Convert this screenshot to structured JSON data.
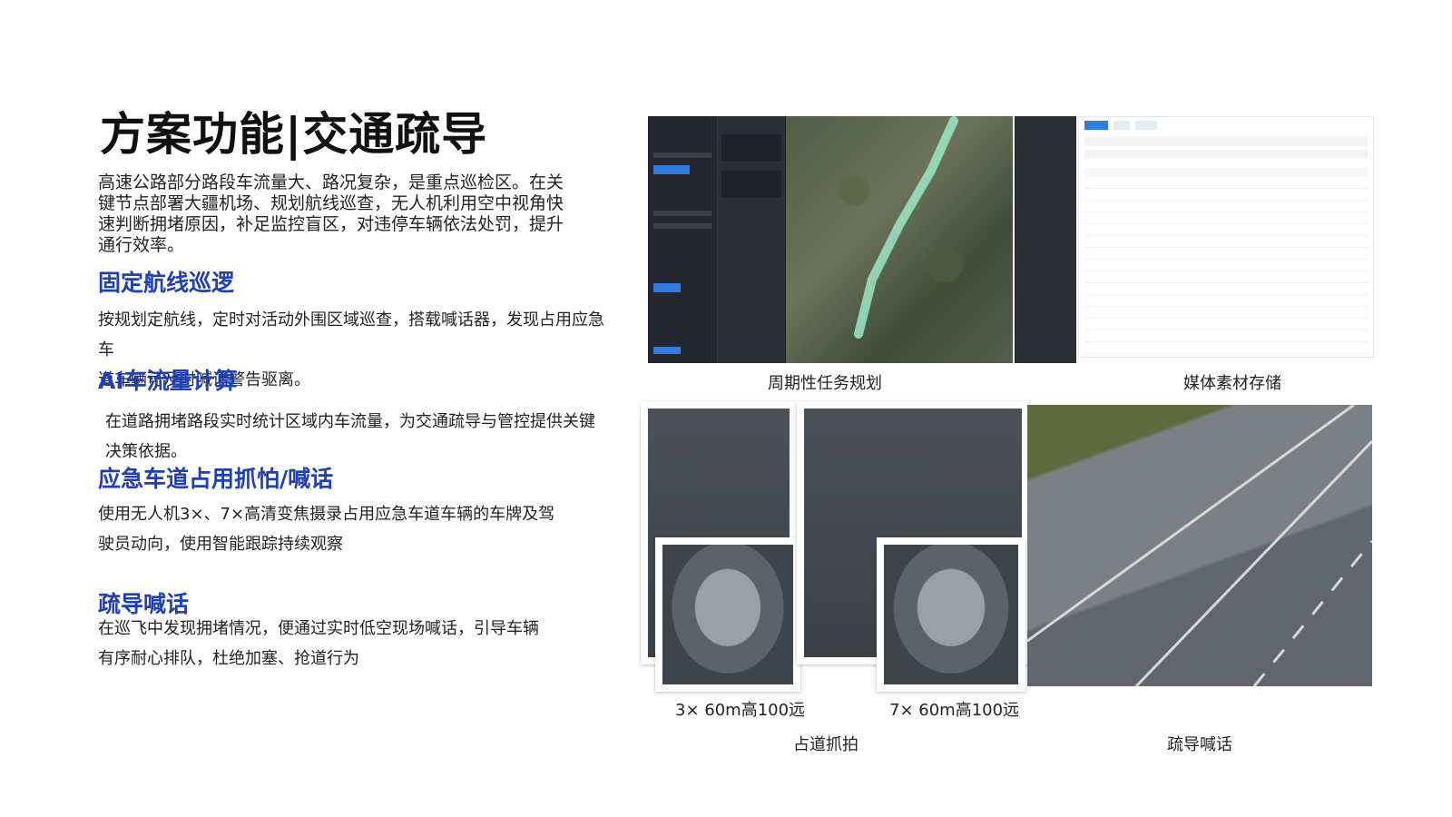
{
  "title": "方案功能|交通疏导",
  "intro_lines": [
    "高速公路部分路段车流量大、路况复杂，是重点巡检区。在关",
    "键节点部署大疆机场、规划航线巡查，无人机利用空中视角快",
    "速判断拥堵原因，补足监控盲区，对违停车辆依法处罚，提升",
    "通行效率。"
  ],
  "sections": [
    {
      "heading": "固定航线巡逻",
      "lines": [
        "按规划定航线，定时对活动外围区域巡查，搭载喊话器，发现占用应急车",
        "道车辆可及时喊话警告驱离。"
      ]
    },
    {
      "heading": "AI车流量计算",
      "lines": [
        "在道路拥堵路段实时统计区域内车流量，为交通疏导与管控提供关键",
        "决策依据。"
      ]
    },
    {
      "heading": "应急车道占用抓怕/喊话",
      "lines": [
        "使用无人机3×、7×高清变焦摄录占用应急车道车辆的车牌及驾",
        "驶员动向，使用智能跟踪持续观察"
      ]
    },
    {
      "heading": "疏导喊话",
      "lines": [
        "在巡飞中发现拥堵情况，便通过实时低空现场喊话，引导车辆",
        "有序耐心排队，杜绝加塞、抢道行为"
      ]
    }
  ],
  "captions": {
    "task_planning": "周期性任务规划",
    "media_storage": "媒体素材存储",
    "zoom_3x": "3×   60m高100远",
    "zoom_7x": "7×   60m高100远",
    "lane_capture": "占道抓拍",
    "guidance_broadcast": "疏导喊话"
  }
}
